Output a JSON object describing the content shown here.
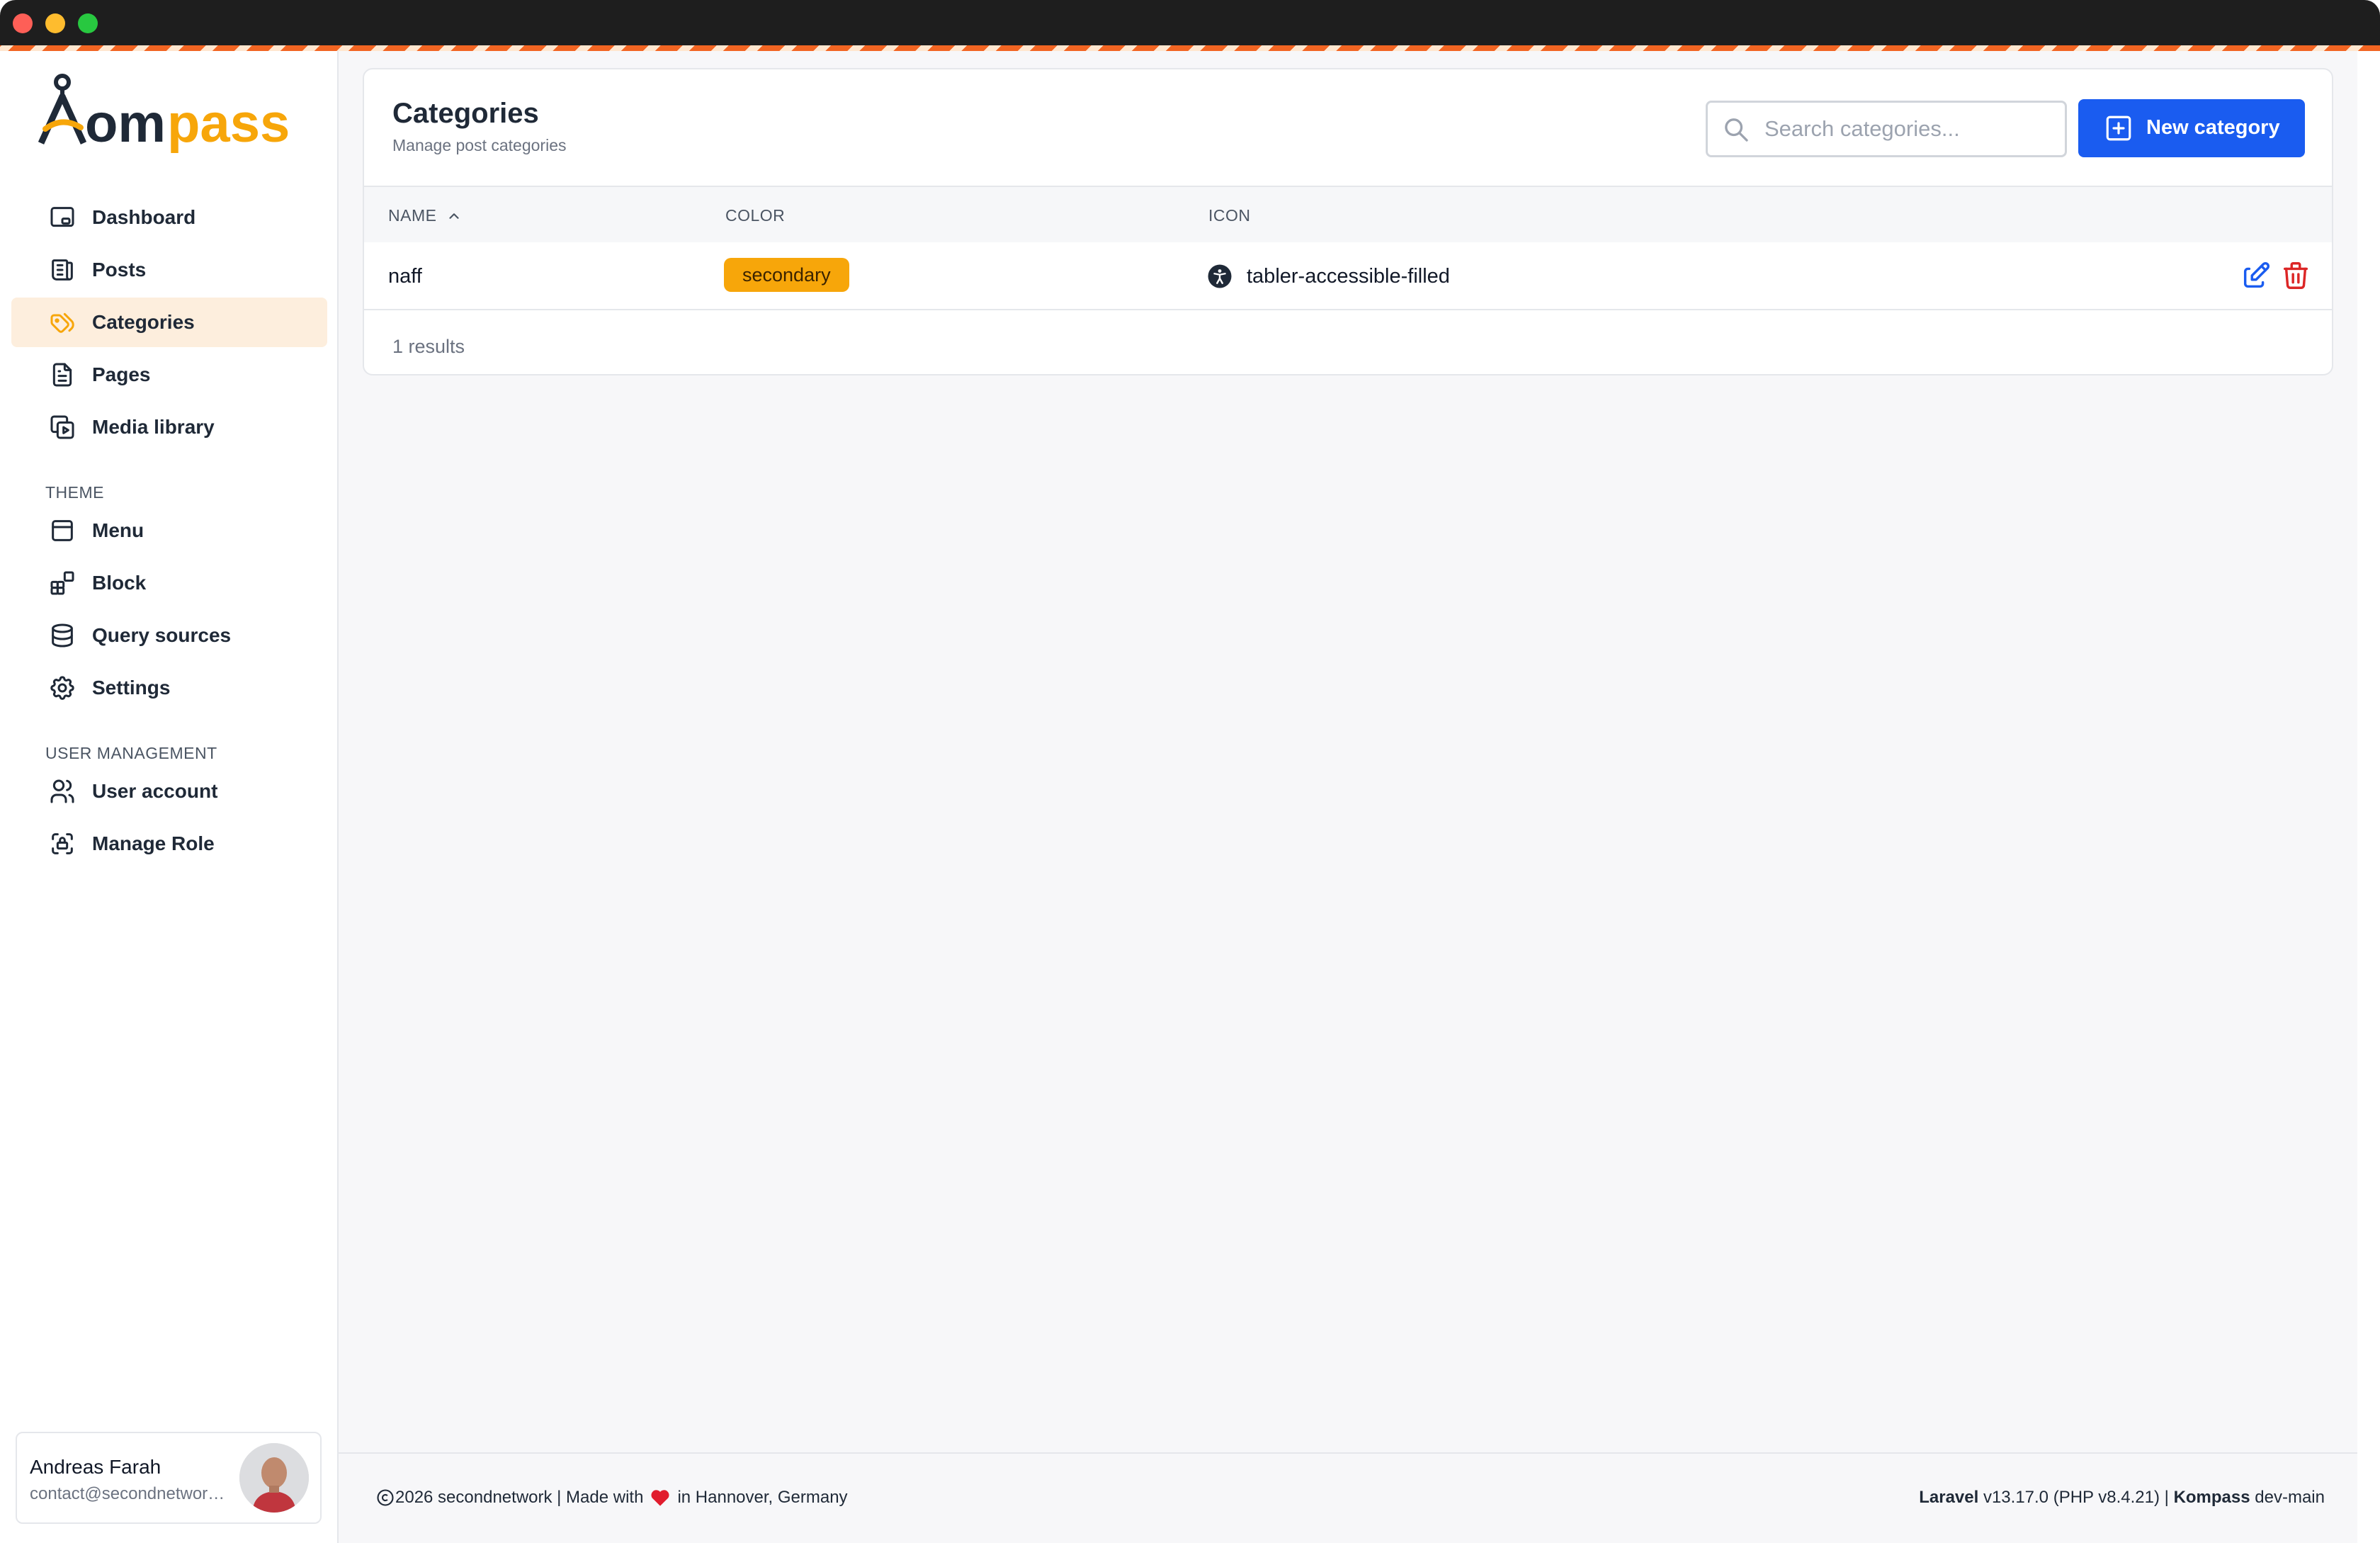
{
  "brand": {
    "logo_text": "Kompass",
    "accent": "#f7a60a",
    "dark": "#1f2937"
  },
  "sidebar": {
    "main_items": [
      {
        "label": "Dashboard",
        "icon": "dashboard-icon"
      },
      {
        "label": "Posts",
        "icon": "posts-icon"
      },
      {
        "label": "Categories",
        "icon": "tags-icon",
        "active": true
      },
      {
        "label": "Pages",
        "icon": "page-icon"
      },
      {
        "label": "Media library",
        "icon": "media-icon"
      }
    ],
    "theme_title": "THEME",
    "theme_items": [
      {
        "label": "Menu",
        "icon": "menu-icon"
      },
      {
        "label": "Block",
        "icon": "block-icon"
      },
      {
        "label": "Query sources",
        "icon": "database-icon"
      },
      {
        "label": "Settings",
        "icon": "gear-icon"
      }
    ],
    "user_mgmt_title": "USER MANAGEMENT",
    "user_items": [
      {
        "label": "User account",
        "icon": "users-icon"
      },
      {
        "label": "Manage Role",
        "icon": "role-icon"
      }
    ],
    "user": {
      "name": "Andreas Farah",
      "email": "contact@secondnetwork.de"
    }
  },
  "header": {
    "title": "Categories",
    "subtitle": "Manage post categories",
    "search_placeholder": "Search categories...",
    "new_button_label": "New category"
  },
  "table": {
    "columns": [
      "NAME",
      "COLOR",
      "ICON"
    ],
    "rows": [
      {
        "name": "naff",
        "color": "secondary",
        "icon": "tabler-accessible-filled"
      }
    ],
    "results_text": "1 results"
  },
  "footer": {
    "copyright": "2026 secondnetwork | Made with",
    "location": "in Hannover, Germany",
    "laravel_label": "Laravel",
    "laravel_version": "v13.17.0 (PHP v8.4.21) |",
    "kompass_label": "Kompass",
    "kompass_version": "dev-main"
  }
}
